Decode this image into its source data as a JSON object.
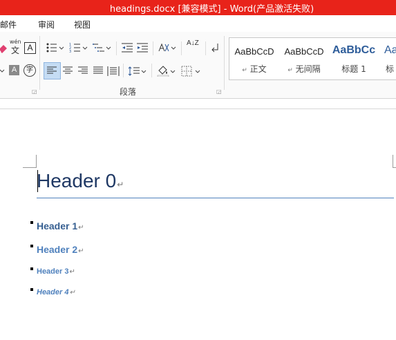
{
  "window": {
    "title": "headings.docx [兼容模式] -  Word(产品激活失败)"
  },
  "menu": {
    "items": [
      "邮件",
      "审阅",
      "视图"
    ]
  },
  "ribbon": {
    "wen_label": "wén",
    "wen_char": "文",
    "a_box": "A",
    "a_shade": "A",
    "a_circle": "字",
    "sort_az": "A↓Z",
    "styles": [
      {
        "sample": "AaBbCcD",
        "name": "正文",
        "arrow": "↵"
      },
      {
        "sample": "AaBbCcD",
        "name": "无间隔",
        "arrow": "↵"
      },
      {
        "sample": "AaBbCc",
        "name": "标题 1",
        "arrow": ""
      },
      {
        "sample": "Aa",
        "name": "标",
        "arrow": ""
      }
    ],
    "group_paragraph": "段落"
  },
  "document": {
    "heading0": "Header 0",
    "headings": [
      {
        "text": "Header 1"
      },
      {
        "text": "Header 2"
      },
      {
        "text": "Header 3"
      },
      {
        "text": "Header 4"
      }
    ],
    "para_mark": "↵"
  },
  "colors": {
    "titlebar": "#e8231a",
    "heading_blue": "#365f91",
    "title_rule": "#4f81bd",
    "selected_button": "#c5dcf4"
  }
}
